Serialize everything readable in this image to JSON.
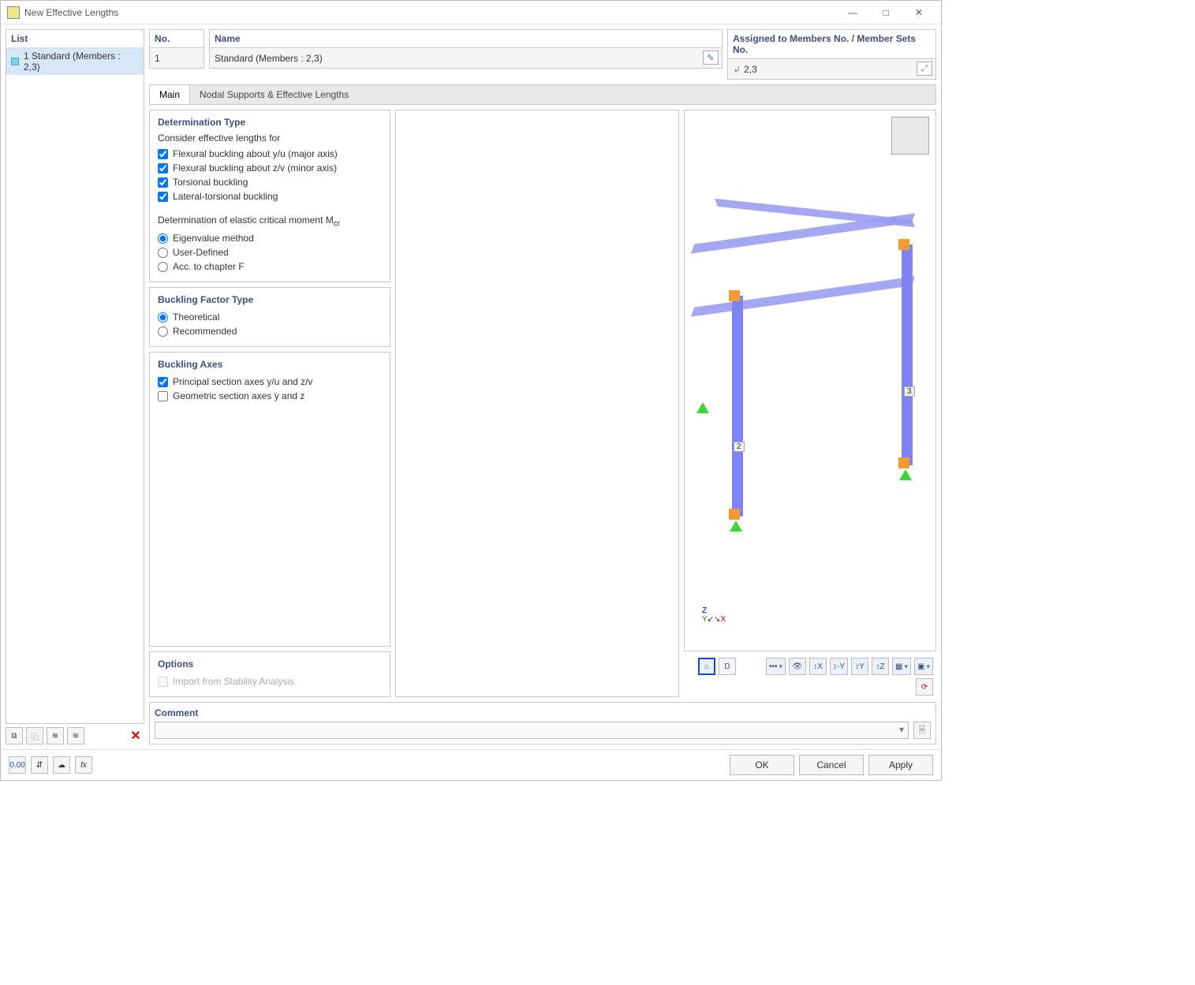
{
  "window": {
    "title": "New Effective Lengths",
    "minimize": "—",
    "maximize": "□",
    "close": "✕"
  },
  "left_panel": {
    "header": "List",
    "item_label": "1 Standard (Members : 2,3)"
  },
  "fields": {
    "no_label": "No.",
    "no_value": "1",
    "name_label": "Name",
    "name_value": "Standard (Members : 2,3)",
    "assigned_label": "Assigned to Members No. / Member Sets No.",
    "assigned_value": "2,3"
  },
  "tabs": {
    "main": "Main",
    "nodal": "Nodal Supports & Effective Lengths"
  },
  "group_det_type": {
    "title": "Determination Type",
    "consider_label": "Consider effective lengths for",
    "chk_flex_y": "Flexural buckling about y/u (major axis)",
    "chk_flex_z": "Flexural buckling about z/v (minor axis)",
    "chk_tors": "Torsional buckling",
    "chk_lat": "Lateral-torsional buckling",
    "mcr_label": "Determination of elastic critical moment M",
    "mcr_sub": "cr",
    "rad_eigen": "Eigenvalue method",
    "rad_user": "User-Defined",
    "rad_chapf": "Acc. to chapter F"
  },
  "group_factor": {
    "title": "Buckling Factor Type",
    "rad_theo": "Theoretical",
    "rad_rec": "Recommended"
  },
  "group_axes": {
    "title": "Buckling Axes",
    "chk_principal": "Principal section axes y/u and z/v",
    "chk_geom": "Geometric section axes y and z"
  },
  "group_options": {
    "title": "Options",
    "chk_import": "Import from Stability Analysis"
  },
  "comment": {
    "title": "Comment",
    "value": ""
  },
  "view_toolbar": {
    "b1": "⌂",
    "b2": "D",
    "b_dots": "•••",
    "b_eye": "👁",
    "b_x": "↕X",
    "b_ny": "↕-Y",
    "b_y": "↕Y",
    "b_z": "↕Z",
    "b_cube": "▦",
    "b_persp": "▣",
    "b_reset": "⟳"
  },
  "labels3d": {
    "m2": "2",
    "m3": "3"
  },
  "footer": {
    "t1": "0.00",
    "t2": "⇵",
    "t3": "☁",
    "t4": "fx",
    "ok": "OK",
    "cancel": "Cancel",
    "apply": "Apply"
  }
}
